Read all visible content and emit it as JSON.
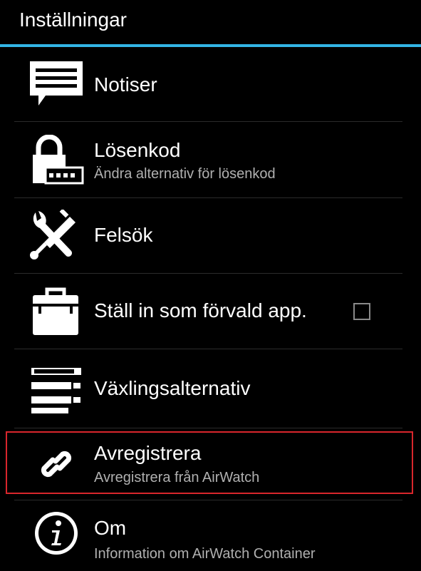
{
  "header": {
    "title": "Inställningar",
    "accent_color": "#33b5e5"
  },
  "items": [
    {
      "title": "Notiser",
      "subtitle": "",
      "icon": "notification-bubble-icon"
    },
    {
      "title": "Lösenkod",
      "subtitle": "Ändra alternativ för lösenkod",
      "icon": "lock-passcode-icon"
    },
    {
      "title": "Felsök",
      "subtitle": "",
      "icon": "wrench-screwdriver-icon"
    },
    {
      "title": "Ställ in som förvald app.",
      "subtitle": "",
      "icon": "briefcase-icon",
      "checkbox_checked": false
    },
    {
      "title": "Växlingsalternativ",
      "subtitle": "",
      "icon": "switch-options-icon"
    },
    {
      "title": "Avregistrera",
      "subtitle": "Avregistrera från AirWatch",
      "icon": "unlink-chain-icon",
      "highlight_color": "#d9262c"
    },
    {
      "title": "Om",
      "subtitle": "Information om AirWatch Container",
      "icon": "info-icon"
    }
  ]
}
